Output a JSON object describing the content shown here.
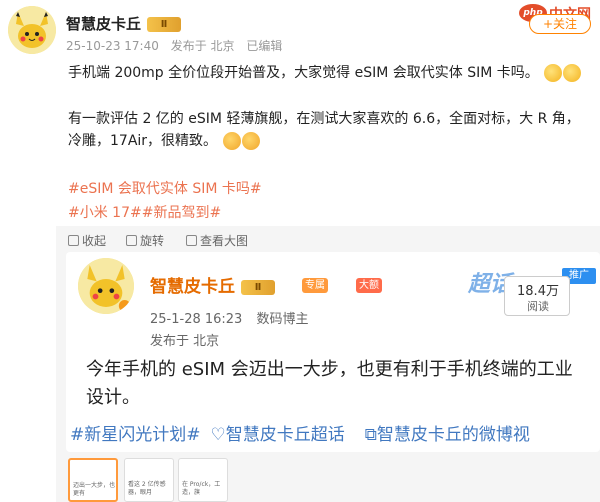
{
  "top_post": {
    "author": "智慧皮卡丘",
    "vip_badge": "Ⅱ",
    "time": "25-10-23 17:40",
    "source": "发布于 北京",
    "edited": "已编辑",
    "follow_label": "+关注",
    "watermark": "中文网",
    "paragraph1": "手机端 200mp 全价位段开始普及，大家觉得 eSIM 会取代实体 SIM 卡吗。",
    "paragraph2": "有一款评估 2 亿的 eSIM 轻薄旗舰，在测试大家喜欢的 6.6，全面对标，大 R 角，冷雕，17Air，很精致。",
    "topics": [
      "#eSIM 会取代实体 SIM 卡吗#",
      "#小米 17##新品驾到#"
    ]
  },
  "actions": {
    "collapse": "收起",
    "rotate": "旋转",
    "view_large": "查看大图"
  },
  "repost": {
    "author": "智慧皮卡丘",
    "vip_badge": "Ⅱ",
    "tag_pro": "专属",
    "tag_big": "大额",
    "chao": "超话",
    "promo": "推广",
    "reads": "18.4万",
    "reads_label": "阅读",
    "time": "25-1-28 16:23",
    "role": "数码博主",
    "source": "发布于 北京",
    "text": "今年手机的 eSIM 会迈出一大步，也更有利于手机终端的工业设计。",
    "topics": [
      "#新星闪光计划#",
      "智慧皮卡丘超话",
      "智慧皮卡丘的微博视"
    ],
    "thumbs": [
      {
        "text": "迈出一大步，也更有"
      },
      {
        "text": "看这 2 亿传感器，眼月"
      },
      {
        "text": "在 Pro/ck，工造，旗"
      }
    ]
  },
  "colors": {
    "accent_orange": "#ff8200",
    "topic_orange": "#eb7350",
    "topic_blue": "#4178c0"
  }
}
